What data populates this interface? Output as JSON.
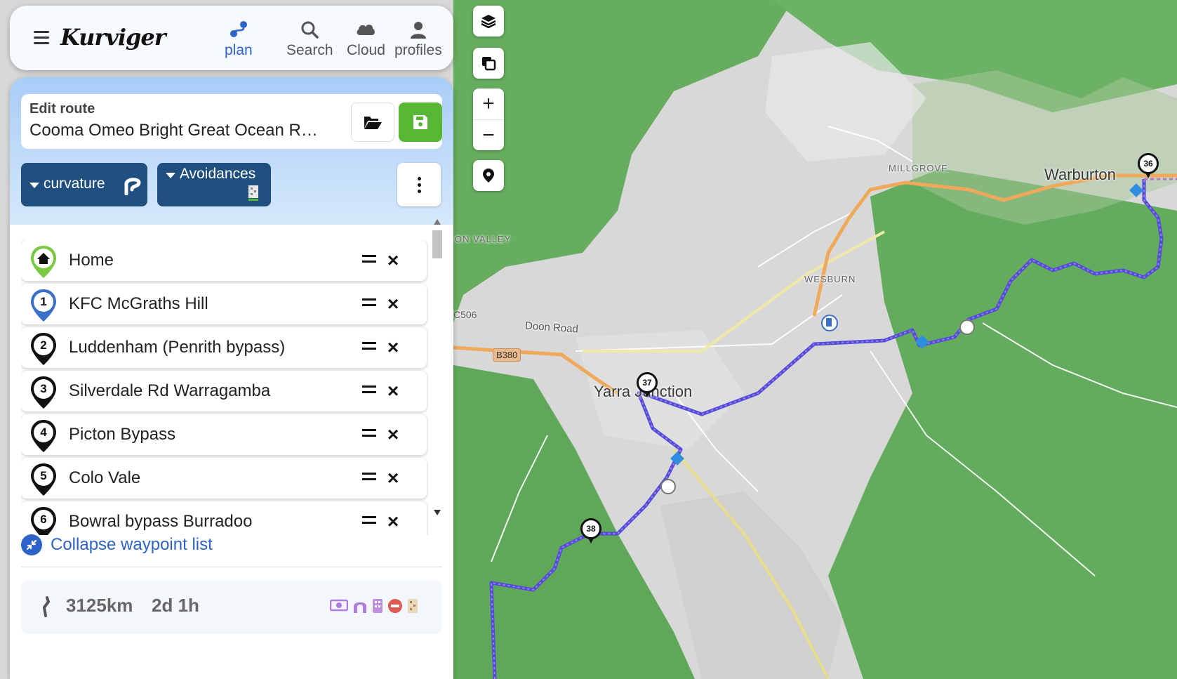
{
  "app": {
    "logo_text": "Kurviger",
    "nav": [
      {
        "label": "plan",
        "icon": "route-plan-icon",
        "active": true
      },
      {
        "label": "Search",
        "icon": "search-icon",
        "active": false
      },
      {
        "label": "Cloud",
        "icon": "cloud-icon",
        "active": false
      },
      {
        "label": "profiles",
        "icon": "user-icon",
        "active": false
      }
    ]
  },
  "route": {
    "edit_label": "Edit route",
    "name": "Cooma Omeo Bright Great Ocean R…",
    "curvature_label": "curvature",
    "avoidances_label": "Avoidances"
  },
  "waypoints": [
    {
      "badge": "",
      "name": "Home",
      "type": "home"
    },
    {
      "badge": "1",
      "name": "KFC McGraths Hill",
      "type": "first"
    },
    {
      "badge": "2",
      "name": "Luddenham (Penrith bypass)",
      "type": "via"
    },
    {
      "badge": "3",
      "name": "Silverdale Rd Warragamba",
      "type": "via"
    },
    {
      "badge": "4",
      "name": "Picton Bypass",
      "type": "via"
    },
    {
      "badge": "5",
      "name": "Colo Vale",
      "type": "via"
    },
    {
      "badge": "6",
      "name": "Bowral bypass Burradoo",
      "type": "via"
    }
  ],
  "collapse_label": "Collapse waypoint list",
  "summary": {
    "distance": "3125km",
    "duration": "2d 1h"
  },
  "map": {
    "labels": {
      "warburton": "Warburton",
      "millgrove": "MILLGROVE",
      "wesburn": "WESBURN",
      "yarra": "Yarra Junction",
      "valley": "ON VALLEY",
      "doon": "Doon Road",
      "c506": "C506",
      "b380": "B380"
    },
    "markers": [
      "36",
      "37",
      "38"
    ],
    "colors": {
      "forest": "#5fa85a",
      "terrain": "#d6d6d6",
      "route": "#4b4fe0",
      "main_road": "#f0a85a"
    }
  }
}
